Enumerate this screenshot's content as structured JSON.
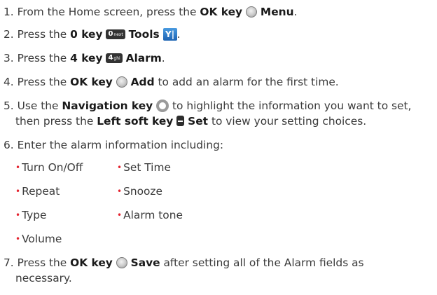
{
  "steps": [
    {
      "num": "1.",
      "pre": "From the Home screen, press the",
      "key": "OK key",
      "action": "Menu",
      "post": "."
    },
    {
      "num": "2.",
      "pre": "Press the",
      "key": "0 key",
      "key_glyph": "0",
      "key_sub": "next",
      "action": "Tools",
      "tools_glyph": "Y|",
      "post": "."
    },
    {
      "num": "3.",
      "pre": "Press the",
      "key": "4 key",
      "key_glyph": "4",
      "key_sub": "ghi",
      "action": "Alarm",
      "post": "."
    },
    {
      "num": "4.",
      "pre": "Press the",
      "key": "OK key",
      "action": "Add",
      "post": "to add an alarm for the first time."
    },
    {
      "num": "5.",
      "pre": "Use the",
      "key": "Navigation key",
      "post1": "to highlight the information you want to set,",
      "line2_pre": "then press the",
      "key2": "Left soft key",
      "action": "Set",
      "post2": "to view your setting choices."
    },
    {
      "num": "6.",
      "text": "Enter the alarm information including:"
    },
    {
      "num": "7.",
      "pre": "Press the",
      "key": "OK key",
      "action": "Save",
      "post1": "after setting all of the Alarm fields as",
      "line2": "necessary."
    }
  ],
  "alarm_fields": [
    "Turn On/Off",
    "Set Time",
    "Repeat",
    "Snooze",
    "Type",
    "Alarm tone",
    "Volume"
  ],
  "bullet_char": "•",
  "colors": {
    "bullet": "#e4232f",
    "text": "#3a3a3a",
    "emphasis": "#1a1a1a"
  },
  "icons": {
    "ok": "ok-key-icon",
    "navigation": "navigation-key-icon",
    "soft_key": "left-soft-key-icon",
    "tools": "tools-icon"
  }
}
